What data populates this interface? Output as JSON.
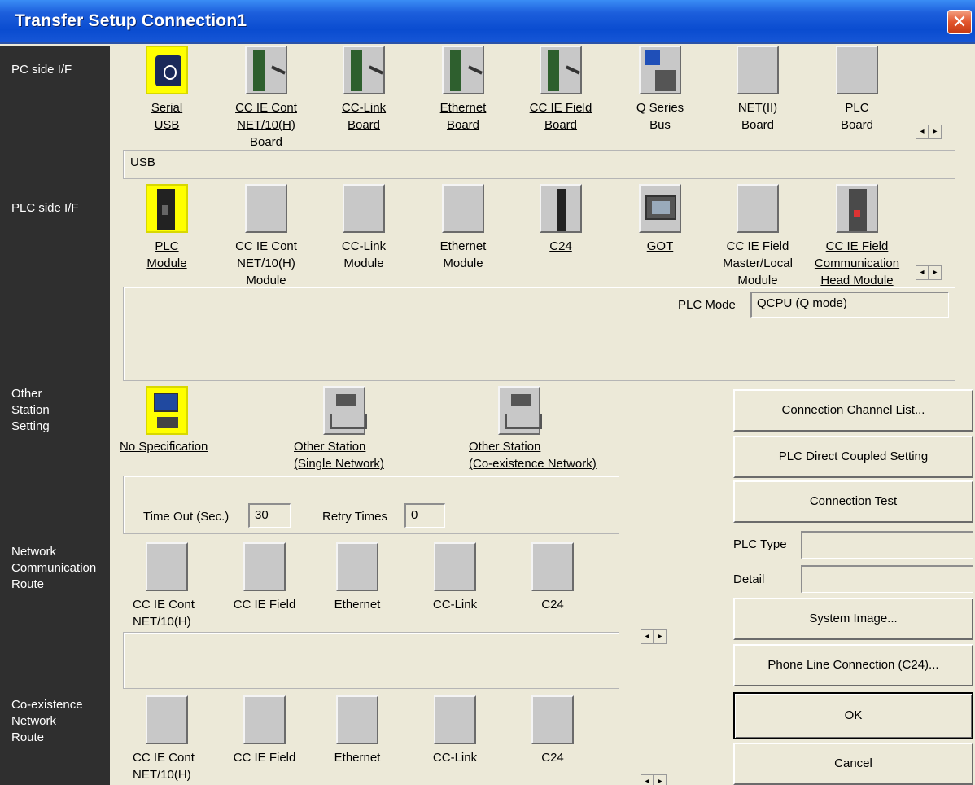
{
  "window": {
    "title": "Transfer Setup Connection1",
    "close_symbol": "✕"
  },
  "left_labels": {
    "pc_side": "PC side I/F",
    "plc_side": "PLC side I/F",
    "other_station": "Other\nStation\nSetting",
    "network_route": "Network\nCommunication\nRoute",
    "coexistence_route": "Co-existence\nNetwork\nRoute"
  },
  "pc_side_items": [
    {
      "label": "Serial\nUSB",
      "icon": "usb-cable-icon",
      "selected": true
    },
    {
      "label": "CC IE Cont\nNET/10(H)\nBoard",
      "icon": "board-icon"
    },
    {
      "label": "CC-Link\nBoard",
      "icon": "board-icon"
    },
    {
      "label": "Ethernet\nBoard",
      "icon": "board-icon"
    },
    {
      "label": "CC IE Field\nBoard",
      "icon": "board-icon"
    },
    {
      "label": "Q Series\nBus",
      "icon": "q-bus-icon"
    },
    {
      "label": "NET(II)\nBoard",
      "icon": "blank-icon"
    },
    {
      "label": "PLC\nBoard",
      "icon": "blank-icon"
    }
  ],
  "pc_side_value": "USB",
  "plc_side_items": [
    {
      "label": "PLC\nModule",
      "icon": "plc-module-icon",
      "selected": true
    },
    {
      "label": "CC IE Cont\nNET/10(H)\nModule",
      "icon": "blank-icon"
    },
    {
      "label": "CC-Link\nModule",
      "icon": "blank-icon"
    },
    {
      "label": "Ethernet\nModule",
      "icon": "blank-icon"
    },
    {
      "label": "C24",
      "icon": "c24-icon"
    },
    {
      "label": "GOT",
      "icon": "got-icon"
    },
    {
      "label": "CC IE Field\nMaster/Local\nModule",
      "icon": "blank-icon"
    },
    {
      "label": "CC IE Field\nCommunication\nHead Module",
      "icon": "head-module-icon"
    }
  ],
  "plc_mode": {
    "label": "PLC Mode",
    "value": "QCPU (Q mode)"
  },
  "other_station_items": [
    {
      "label": "No Specification",
      "icon": "pc-icon",
      "selected": true
    },
    {
      "label": "Other Station\n(Single Network)",
      "icon": "network-icon"
    },
    {
      "label": "Other Station\n(Co-existence Network)",
      "icon": "network-icon"
    }
  ],
  "timeout": {
    "label": "Time Out (Sec.)",
    "value": "30"
  },
  "retry": {
    "label": "Retry Times",
    "value": "0"
  },
  "network_route_items": [
    {
      "label": "CC IE Cont\nNET/10(H)"
    },
    {
      "label": "CC IE Field"
    },
    {
      "label": "Ethernet"
    },
    {
      "label": "CC-Link"
    },
    {
      "label": "C24"
    }
  ],
  "coexistence_route_items": [
    {
      "label": "CC IE Cont\nNET/10(H)"
    },
    {
      "label": "CC IE Field"
    },
    {
      "label": "Ethernet"
    },
    {
      "label": "CC-Link"
    },
    {
      "label": "C24"
    }
  ],
  "buttons": {
    "connection_channel_list": "Connection Channel List...",
    "plc_direct_coupled": "PLC Direct Coupled Setting",
    "connection_test": "Connection Test",
    "system_image": "System Image...",
    "phone_line": "Phone Line Connection (C24)...",
    "ok": "OK",
    "cancel": "Cancel"
  },
  "plc_type": {
    "label": "PLC Type",
    "value": ""
  },
  "detail": {
    "label": "Detail",
    "value": ""
  },
  "scroll_left": "◂",
  "scroll_right": "▸"
}
